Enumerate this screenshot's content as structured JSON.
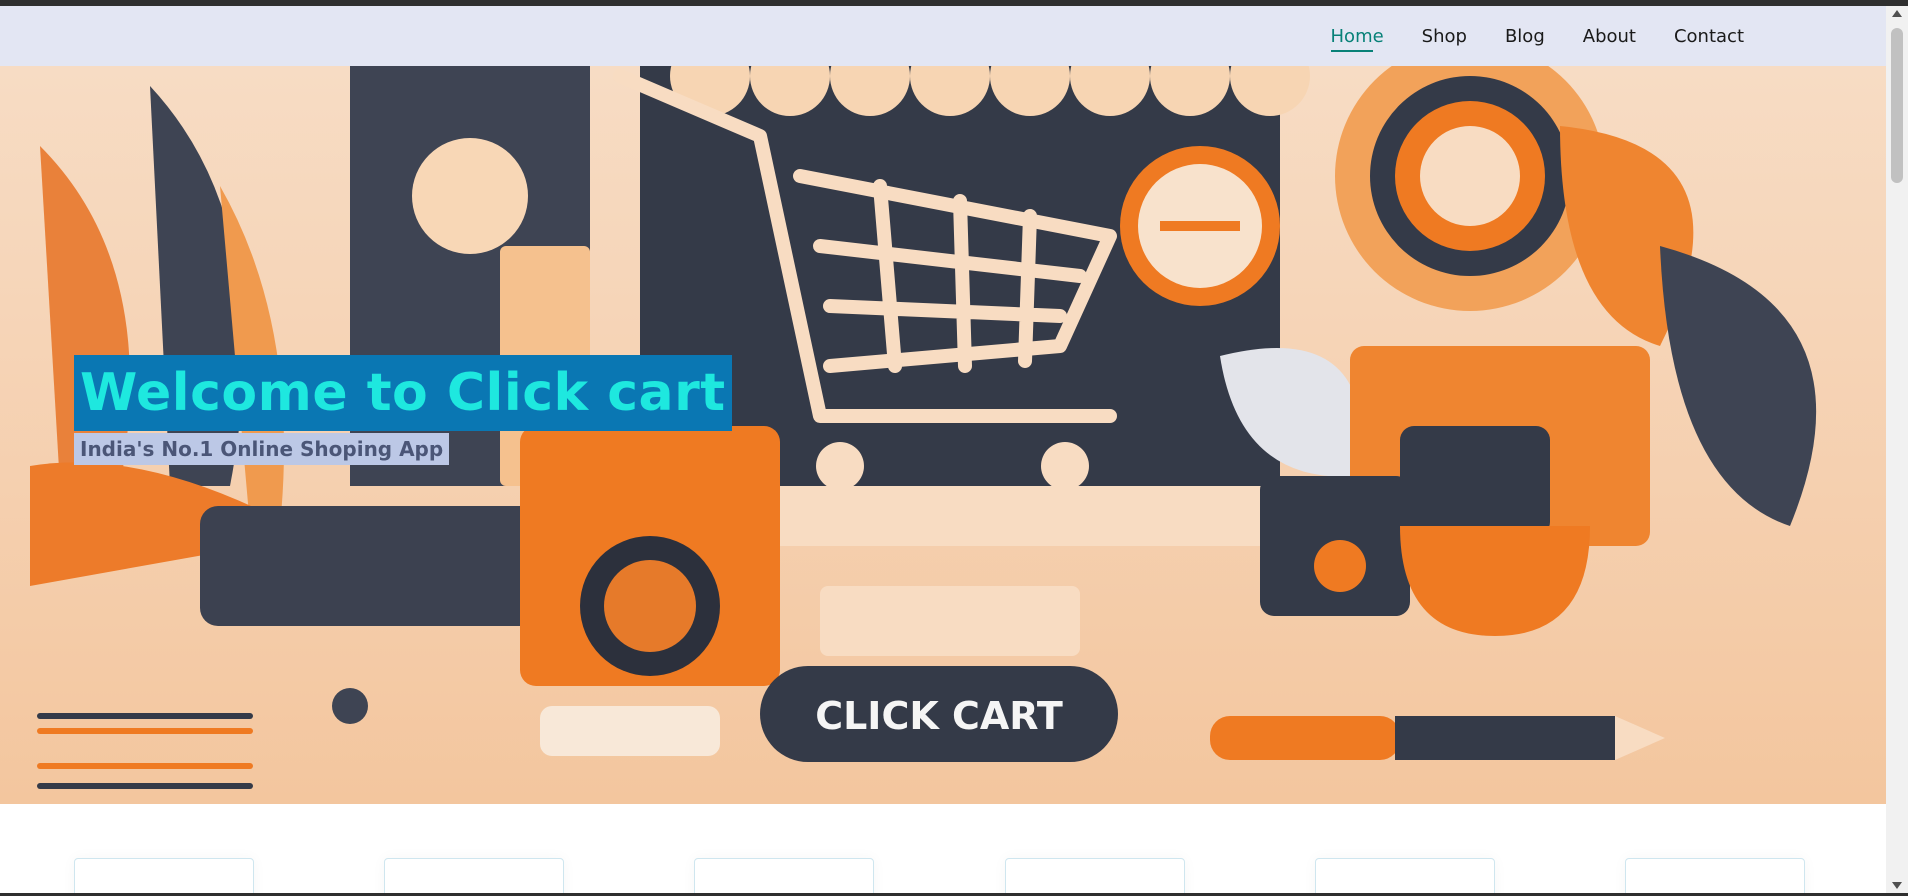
{
  "nav": {
    "items": [
      {
        "label": "Home",
        "active": true
      },
      {
        "label": "Shop",
        "active": false
      },
      {
        "label": "Blog",
        "active": false
      },
      {
        "label": "About",
        "active": false
      },
      {
        "label": "Contact",
        "active": false
      }
    ],
    "active_color": "#088178",
    "background": "#e3e6f3"
  },
  "hero": {
    "title": "Welcome to Click cart",
    "subtitle": "India's No.1 Online Shoping App",
    "image_badge_text": "CLICK CART",
    "accent_color": "#f07a1c",
    "dark_color": "#343a48"
  },
  "features": {
    "card_count": 6
  }
}
